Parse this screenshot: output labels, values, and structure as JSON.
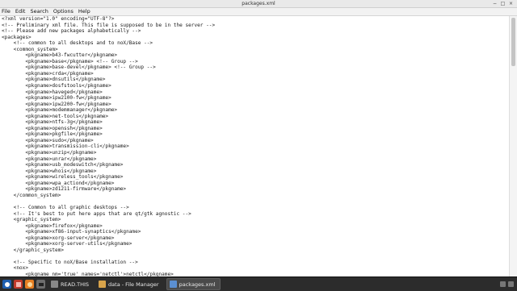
{
  "window": {
    "title": "packages.xml",
    "controls": [
      "−",
      "□",
      "×"
    ]
  },
  "menubar": {
    "items": [
      "File",
      "Edit",
      "Search",
      "Options",
      "Help"
    ]
  },
  "editor": {
    "lines": [
      "<?xml version=\"1.0\" encoding=\"UTF-8\"?>",
      "<!-- Preliminary xml file. This file is supposed to be in the server -->",
      "<!-- Please add new packages alphabetically -->",
      "<packages>",
      "    <!-- common to all desktops and to noX/Base -->",
      "    <common_system>",
      "        <pkgname>b43-fwcutter</pkgname>",
      "        <pkgname>base</pkgname> <!-- Group -->",
      "        <pkgname>base-devel</pkgname> <!-- Group -->",
      "        <pkgname>crda</pkgname>",
      "        <pkgname>dnsutils</pkgname>",
      "        <pkgname>dosfstools</pkgname>",
      "        <pkgname>haveged</pkgname>",
      "        <pkgname>ipw2100-fw</pkgname>",
      "        <pkgname>ipw2200-fw</pkgname>",
      "        <pkgname>modemmanager</pkgname>",
      "        <pkgname>net-tools</pkgname>",
      "        <pkgname>ntfs-3g</pkgname>",
      "        <pkgname>openssh</pkgname>",
      "        <pkgname>pkgfile</pkgname>",
      "        <pkgname>sudo</pkgname>",
      "        <pkgname>transmission-cli</pkgname>",
      "        <pkgname>unzip</pkgname>",
      "        <pkgname>unrar</pkgname>",
      "        <pkgname>usb_modeswitch</pkgname>",
      "        <pkgname>whois</pkgname>",
      "        <pkgname>wireless_tools</pkgname>",
      "        <pkgname>wpa_actiond</pkgname>",
      "        <pkgname>zd1211-firmware</pkgname>",
      "    </common_system>",
      "",
      "    <!-- Common to all graphic desktops -->",
      "    <!-- It's best to put here apps that are qt/gtk agnostic -->",
      "    <graphic_system>",
      "        <pkgname>firefox</pkgname>",
      "        <pkgname>xf86-input-synaptics</pkgname>",
      "        <pkgname>xorg-server</pkgname>",
      "        <pkgname>xorg-server-utils</pkgname>",
      "    </graphic_system>",
      "",
      "    <!-- Specific to noX/Base installation -->",
      "    <nox>",
      "        <pkgname nm='true' names='netctl'>netctl</pkgname>"
    ]
  },
  "taskbar": {
    "tasks": [
      {
        "label": "READ.THIS",
        "active": false
      },
      {
        "label": "data - File Manager",
        "active": false
      },
      {
        "label": "packages.xml",
        "active": true
      }
    ]
  },
  "colors": {
    "taskbar_bg": "#2c2c2c",
    "launcher_red": "#c0392b",
    "launcher_orange": "#e67e22",
    "launcher_gray": "#6d6d6d"
  }
}
